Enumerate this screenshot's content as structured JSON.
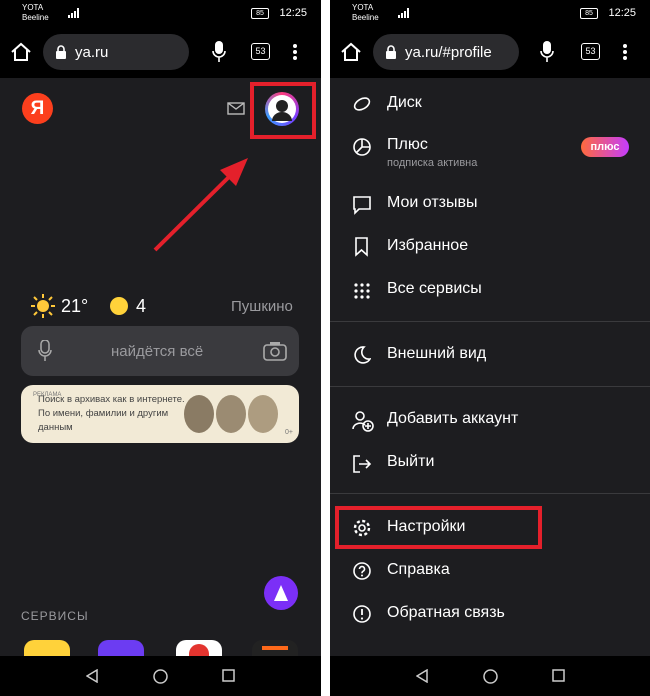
{
  "left": {
    "status": {
      "carrier_line1": "YOTA",
      "carrier_line2": "Beeline",
      "battery": "85",
      "time": "12:25"
    },
    "browser": {
      "url": "ya.ru",
      "tabs_count": "53"
    },
    "header": {
      "logo_letter": "Я"
    },
    "weather": {
      "temperature": "21°",
      "moon_count": "4",
      "location": "Пушкино"
    },
    "search": {
      "placeholder": "найдётся всё"
    },
    "ad": {
      "tag": "РЕКЛАМА",
      "text": "Поиск в архивах как в интернете. По имени, фамилии и другим данным",
      "age": "0+"
    },
    "services": {
      "heading": "СЕРВИСЫ"
    }
  },
  "right": {
    "status": {
      "carrier_line1": "YOTA",
      "carrier_line2": "Beeline",
      "battery": "85",
      "time": "12:25"
    },
    "browser": {
      "url": "ya.ru/#profile",
      "tabs_count": "53"
    },
    "menu": {
      "disk": "Диск",
      "plus": "Плюс",
      "plus_sub": "подписка активна",
      "plus_badge": "плюс",
      "reviews": "Мои отзывы",
      "favorites": "Избранное",
      "all_services": "Все сервисы",
      "appearance": "Внешний вид",
      "add_account": "Добавить аккаунт",
      "logout": "Выйти",
      "settings": "Настройки",
      "help": "Справка",
      "feedback": "Обратная связь"
    }
  },
  "colors": {
    "highlight": "#e4202b",
    "yandex_red": "#fc3f1d",
    "alice": "#7b2ff7",
    "background": "#1d1d20"
  }
}
